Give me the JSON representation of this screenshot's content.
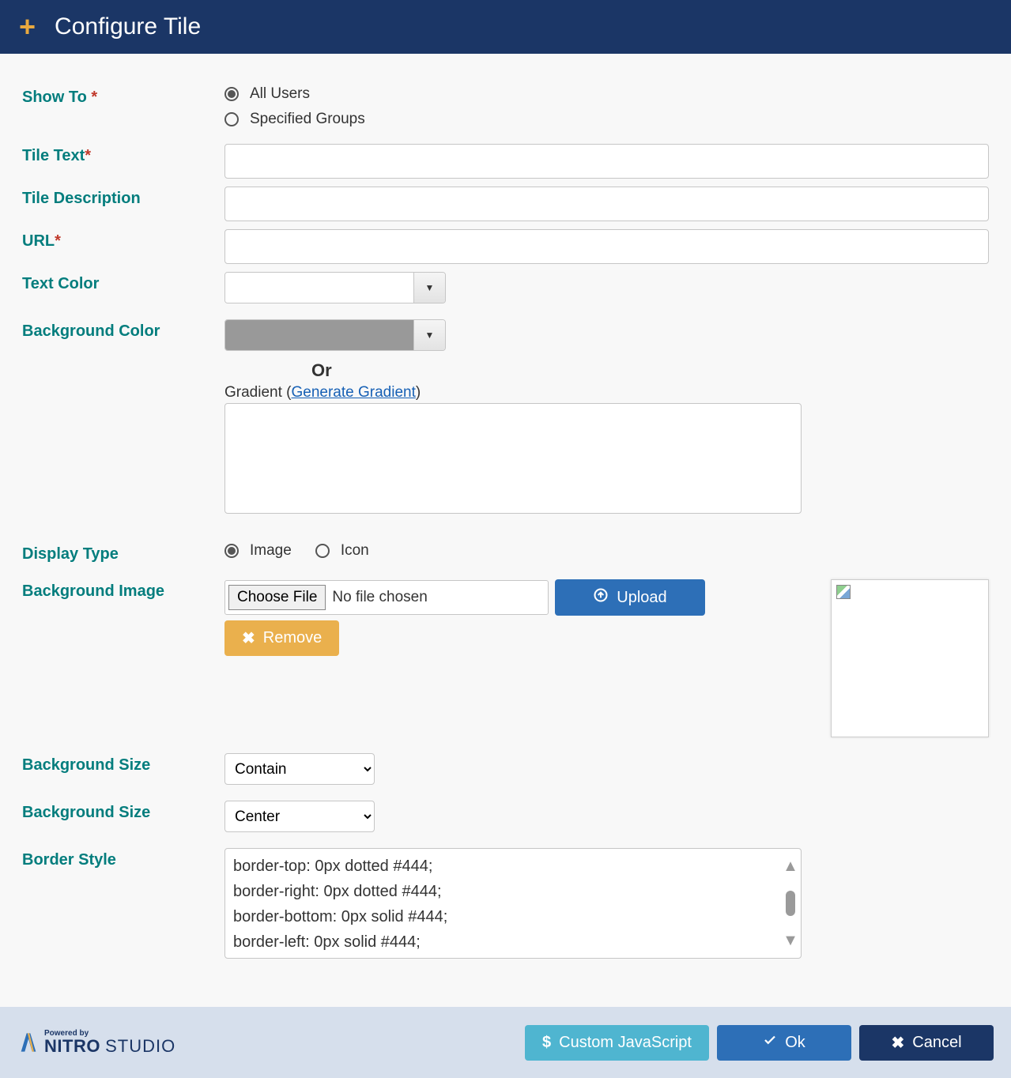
{
  "header": {
    "title": "Configure Tile"
  },
  "labels": {
    "show_to": "Show To",
    "tile_text": "Tile Text",
    "tile_description": "Tile Description",
    "url": "URL",
    "text_color": "Text Color",
    "background_color": "Background Color",
    "or": "Or",
    "gradient_prefix": "Gradient (",
    "gradient_link": "Generate Gradient",
    "gradient_suffix": ")",
    "display_type": "Display Type",
    "background_image": "Background Image",
    "background_size1": "Background Size",
    "background_size2": "Background Size",
    "border_style": "Border Style"
  },
  "show_to_options": {
    "all_users": "All Users",
    "specified_groups": "Specified Groups",
    "selected": "all_users"
  },
  "display_type_options": {
    "image": "Image",
    "icon": "Icon",
    "selected": "image"
  },
  "buttons": {
    "choose_file": "Choose File",
    "no_file": "No file chosen",
    "upload": "Upload",
    "remove": "Remove",
    "custom_js": "Custom JavaScript",
    "ok": "Ok",
    "cancel": "Cancel"
  },
  "selects": {
    "bg_size1": "Contain",
    "bg_size2": "Center"
  },
  "colors": {
    "text_color_swatch": "#ffffff",
    "bg_color_swatch": "#999999"
  },
  "border_style_text": "border-top: 0px dotted #444;\nborder-right: 0px dotted #444;\nborder-bottom: 0px solid #444;\nborder-left: 0px solid #444;",
  "brand": {
    "powered_by": "Powered by",
    "name_bold": "NITRO",
    "name_light": "STUDIO"
  }
}
